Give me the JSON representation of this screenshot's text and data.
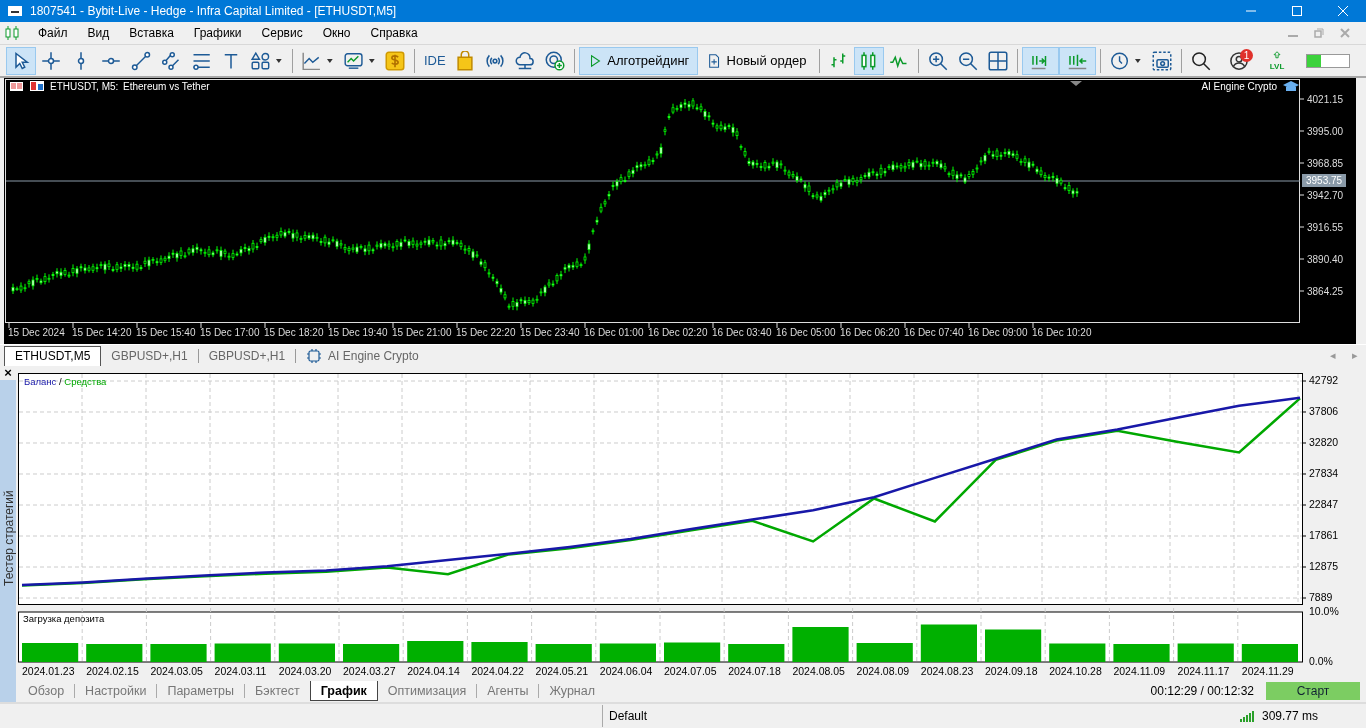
{
  "window": {
    "title": "1807541 - Bybit-Live - Hedge - Infra Capital Limited - [ETHUSDT,M5]"
  },
  "menu": [
    "Файл",
    "Вид",
    "Вставка",
    "Графики",
    "Сервис",
    "Окно",
    "Справка"
  ],
  "tools": [
    {
      "selected": true
    },
    {
      "selected": false
    },
    {
      "selected": false
    },
    {
      "selected": false
    },
    {
      "selected": false
    },
    {
      "selected": false
    },
    {
      "selected": false
    },
    {
      "selected": false
    },
    {
      "selected": false
    }
  ],
  "toolbar": {
    "ide_label": "IDE",
    "algo": {
      "label": "Алготрейдинг",
      "selected": true
    },
    "new_order": {
      "label": "Новый ордер"
    },
    "chart_types": [
      {
        "selected": false
      },
      {
        "selected": true
      },
      {
        "selected": false
      }
    ],
    "view_toggles": [
      {
        "selected": true
      },
      {
        "selected": true
      }
    ],
    "notifications_badge": "1",
    "lvl_label": "LVL",
    "meter": {
      "level": 0.33
    }
  },
  "chart": {
    "symbol": "ETHUSDT, M5:",
    "description": "Ethereum vs Tether",
    "indicator": "AI Engine Crypto",
    "price_ticks": [
      "4021.15",
      "3995.00",
      "3968.85",
      "3942.70",
      "3916.55",
      "3890.40",
      "3864.25"
    ],
    "current_price": "3953.75",
    "time_labels": [
      "15 Dec 2024",
      "15 Dec 14:20",
      "15 Dec 15:40",
      "15 Dec 17:00",
      "15 Dec 18:20",
      "15 Dec 19:40",
      "15 Dec 21:00",
      "15 Dec 22:20",
      "15 Dec 23:40",
      "16 Dec 01:00",
      "16 Dec 02:20",
      "16 Dec 03:40",
      "16 Dec 05:00",
      "16 Dec 06:20",
      "16 Dec 07:40",
      "16 Dec 09:00",
      "16 Dec 10:20"
    ]
  },
  "chart_tabs": [
    {
      "label": "ETHUSDT,M5",
      "kind": "chart",
      "selected": true
    },
    {
      "label": "GBPUSD+,H1",
      "kind": "chart",
      "selected": false
    },
    {
      "label": "GBPUSD+,H1",
      "kind": "chart",
      "selected": false
    },
    {
      "label": "AI Engine Crypto",
      "kind": "indicator",
      "selected": false
    }
  ],
  "tab_scroll": [
    "◂",
    "▸"
  ],
  "tester": {
    "title": "Тестер стратегий",
    "close": "×",
    "balance_chart": {
      "legend_separator": " / ",
      "chart_data": {
        "type": "line",
        "grid": true,
        "ylim": [
          7889,
          42792
        ],
        "yticks": [
          7889,
          12875,
          17861,
          22847,
          27834,
          32820,
          37806,
          42792
        ],
        "series": [
          {
            "name": "Баланс",
            "color": "#1818a8",
            "values": [
              10000,
              10400,
              11000,
              11500,
              12000,
              12300,
              13000,
              14000,
              15000,
              16100,
              17400,
              19000,
              20500,
              22000,
              24100,
              27200,
              30300,
              33400,
              35000,
              36900,
              38800,
              40100
            ]
          },
          {
            "name": "Средства",
            "color": "#00a800",
            "values": [
              9900,
              10300,
              10900,
              11400,
              11800,
              12100,
              12800,
              11700,
              14900,
              15900,
              17200,
              18800,
              20300,
              17000,
              23900,
              20200,
              30100,
              33200,
              34800,
              33000,
              31300,
              40000
            ]
          }
        ]
      }
    },
    "deposit_chart": {
      "chart_data": {
        "type": "bar",
        "grid": true,
        "categories": [
          "2024.01.23",
          "2024.02.15",
          "2024.03.05",
          "2024.03.11",
          "2024.03.20",
          "2024.03.27",
          "2024.04.14",
          "2024.04.22",
          "2024.05.21",
          "2024.06.04",
          "2024.07.05",
          "2024.07.18",
          "2024.08.05",
          "2024.08.09",
          "2024.08.23",
          "2024.09.18",
          "2024.10.28",
          "2024.11.09",
          "2024.11.17",
          "2024.11.29"
        ],
        "ylim": [
          0,
          10
        ],
        "yticks": [
          {
            "value": 0,
            "label": "0.0%"
          },
          {
            "value": 10,
            "label": "10.0%"
          }
        ],
        "series": [
          {
            "name": "Загрузка депозита",
            "color": "#00b000",
            "values": [
              3.8,
              3.6,
              3.6,
              3.7,
              3.7,
              3.6,
              4.2,
              4.0,
              3.6,
              3.7,
              3.9,
              3.6,
              7.0,
              3.8,
              7.5,
              6.5,
              3.7,
              3.6,
              3.7,
              3.6
            ]
          }
        ]
      }
    },
    "tabs": [
      {
        "label": "Обзор",
        "selected": false
      },
      {
        "label": "Настройки",
        "selected": false
      },
      {
        "label": "Параметры",
        "selected": false
      },
      {
        "label": "Бэктест",
        "selected": false
      },
      {
        "label": "График",
        "selected": true
      },
      {
        "label": "Оптимизация",
        "selected": false
      },
      {
        "label": "Агенты",
        "selected": false
      },
      {
        "label": "Журнал",
        "selected": false
      }
    ],
    "elapsed": "00:12:29 / 00:12:32",
    "start_button": "Старт"
  },
  "status_bar": {
    "profile": "Default",
    "ping": "309.77 ms"
  }
}
